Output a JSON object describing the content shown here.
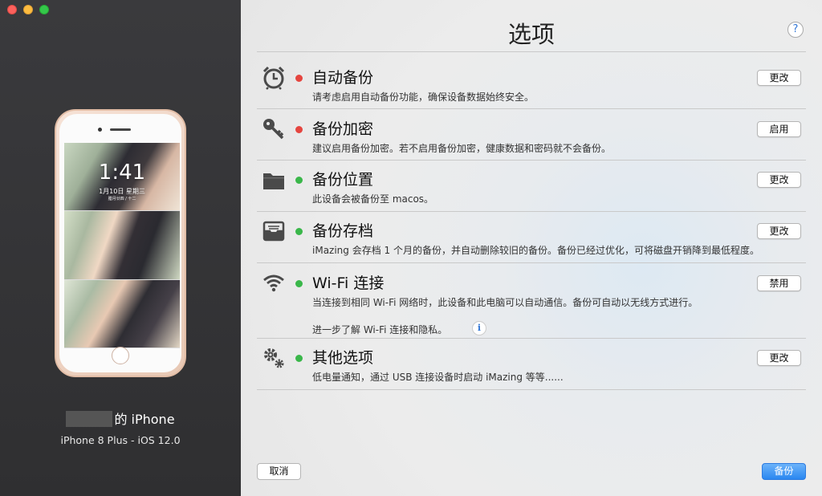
{
  "window": {
    "title": "选项",
    "help_label": "?"
  },
  "device": {
    "name_suffix": "的 iPhone",
    "model": "iPhone 8 Plus - iOS 12.0",
    "lock_time": "1:41",
    "lock_date": "1月10日 星期三",
    "lock_sub": "腊月廿四 / 十二"
  },
  "options": [
    {
      "icon": "alarm-clock-icon",
      "status": "red",
      "name": "自动备份",
      "desc": "请考虑启用自动备份功能，确保设备数据始终安全。",
      "button": "更改"
    },
    {
      "icon": "key-icon",
      "status": "red",
      "name": "备份加密",
      "desc": "建议启用备份加密。若不启用备份加密，健康数据和密码就不会备份。",
      "button": "启用"
    },
    {
      "icon": "folder-icon",
      "status": "green",
      "name": "备份位置",
      "desc": "此设备会被备份至 macos。",
      "button": "更改"
    },
    {
      "icon": "archive-tray-icon",
      "status": "green",
      "name": "备份存档",
      "desc": "iMazing 会存档 1 个月的备份，并自动删除较旧的备份。备份已经过优化，可将磁盘开销降到最低程度。",
      "button": "更改"
    },
    {
      "icon": "wifi-icon",
      "status": "green",
      "name": "Wi-Fi 连接",
      "desc": "当连接到相同 Wi-Fi 网络时，此设备和此电脑可以自动通信。备份可自动以无线方式进行。",
      "desc2": "进一步了解 Wi-Fi 连接和隐私。",
      "info": "i",
      "button": "禁用"
    },
    {
      "icon": "gears-icon",
      "status": "green",
      "name": "其他选项",
      "desc": "低电量通知，通过 USB 连接设备时启动 iMazing 等等......",
      "button": "更改"
    }
  ],
  "footer": {
    "cancel_label": "取消",
    "backup_label": "备份"
  },
  "colors": {
    "status_red": "#e5453f",
    "status_green": "#3ab74a",
    "primary_button": "#2a87f0"
  }
}
